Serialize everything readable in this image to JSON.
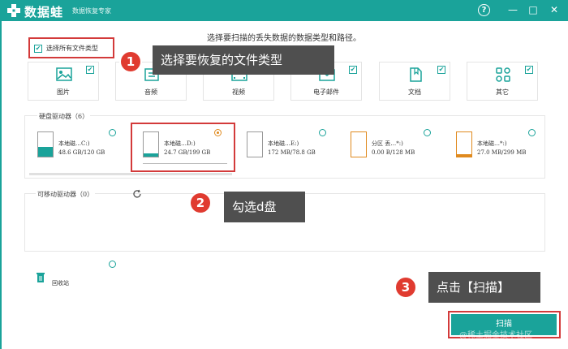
{
  "titlebar": {
    "app_name": "数据蛙",
    "subtitle": "数据恢复专家",
    "help_icon": "?",
    "minimize_icon": "—",
    "maximize_icon": "□",
    "close_icon": "✕"
  },
  "heading": "选择要扫描的丢失数据的数据类型和路径。",
  "select_all": {
    "label": "选择所有文件类型",
    "checked": true
  },
  "file_types": [
    {
      "label": "图片",
      "icon": "image-icon",
      "checked": true
    },
    {
      "label": "音频",
      "icon": "audio-icon",
      "checked": true
    },
    {
      "label": "视频",
      "icon": "video-icon",
      "checked": true
    },
    {
      "label": "电子邮件",
      "icon": "email-icon",
      "checked": true
    },
    {
      "label": "文档",
      "icon": "document-icon",
      "checked": true
    },
    {
      "label": "其它",
      "icon": "other-icon",
      "checked": true
    }
  ],
  "callouts": [
    {
      "number": "1",
      "text": "选择要恢复的文件类型"
    },
    {
      "number": "2",
      "text": "勾选d盘"
    },
    {
      "number": "3",
      "text": "点击【扫描】"
    }
  ],
  "hard_drives": {
    "title": "硬盘驱动器（6）",
    "drives": [
      {
        "name": "本地磁…C:)",
        "size": "48.6 GB/120 GB",
        "fill": 0.4,
        "color": "teal",
        "selected": false
      },
      {
        "name": "本地磁…D:)",
        "size": "24.7 GB/199 GB",
        "fill": 0.12,
        "color": "teal",
        "selected": true
      },
      {
        "name": "本地磁…E:)",
        "size": "172 MB/78.8 GB",
        "fill": 0.0,
        "color": "teal",
        "selected": false
      },
      {
        "name": "分区 丢…*:)",
        "size": "0.00  B/128 MB",
        "fill": 0.0,
        "color": "orange",
        "selected": false
      },
      {
        "name": "本地磁…*:)",
        "size": "27.0 MB/299 MB",
        "fill": 0.09,
        "color": "orange",
        "selected": false
      }
    ]
  },
  "removable": {
    "title": "可移动驱动器（0）",
    "refresh_icon": "refresh-icon"
  },
  "recycle_bin": {
    "label": "回收站",
    "icon": "trash-icon"
  },
  "scan_button": {
    "label": "扫描"
  },
  "watermark": "@稀土掘金技术社区",
  "colors": {
    "accent": "#1aa39a",
    "callout": "#4f4f4f",
    "badge": "#e03b30",
    "highlight": "#d33a3a",
    "orange": "#e08a1e"
  }
}
